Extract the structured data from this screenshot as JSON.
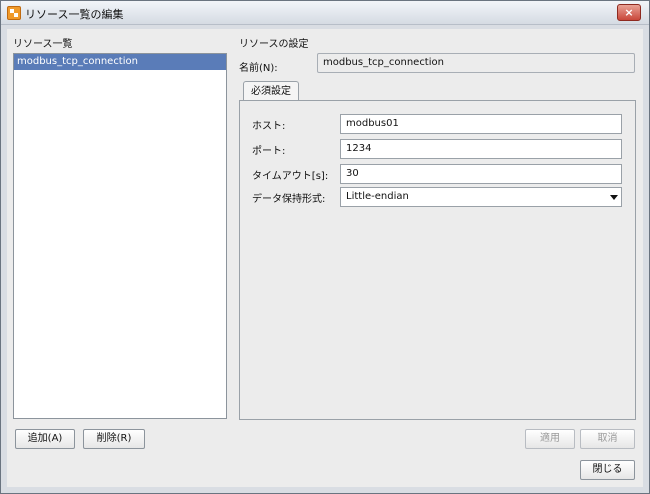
{
  "window": {
    "title": "リソース一覧の編集",
    "close_glyph": "×"
  },
  "left": {
    "heading": "リソース一覧",
    "items": [
      {
        "label": "modbus_tcp_connection",
        "selected": true
      }
    ],
    "add_button": "追加(A)",
    "delete_button": "削除(R)"
  },
  "right": {
    "heading": "リソースの設定",
    "name_label": "名前(N):",
    "name_value": "modbus_tcp_connection",
    "tab_label": "必須設定",
    "fields": {
      "host_label": "ホスト:",
      "host_value": "modbus01",
      "port_label": "ポート:",
      "port_value": "1234",
      "timeout_label": "タイムアウト[s]:",
      "timeout_value": "30",
      "byteorder_label": "データ保持形式:",
      "byteorder_value": "Little-endian"
    },
    "apply_button": "適用",
    "cancel_button": "取消",
    "close_button": "閉じる"
  },
  "colors": {
    "selection": "#5a7cb8",
    "close_button": "#c9473a",
    "app_icon": "#f09a2a"
  },
  "icons": {
    "app": "app-icon",
    "close": "close-icon",
    "dropdown": "chevron-down-icon"
  }
}
